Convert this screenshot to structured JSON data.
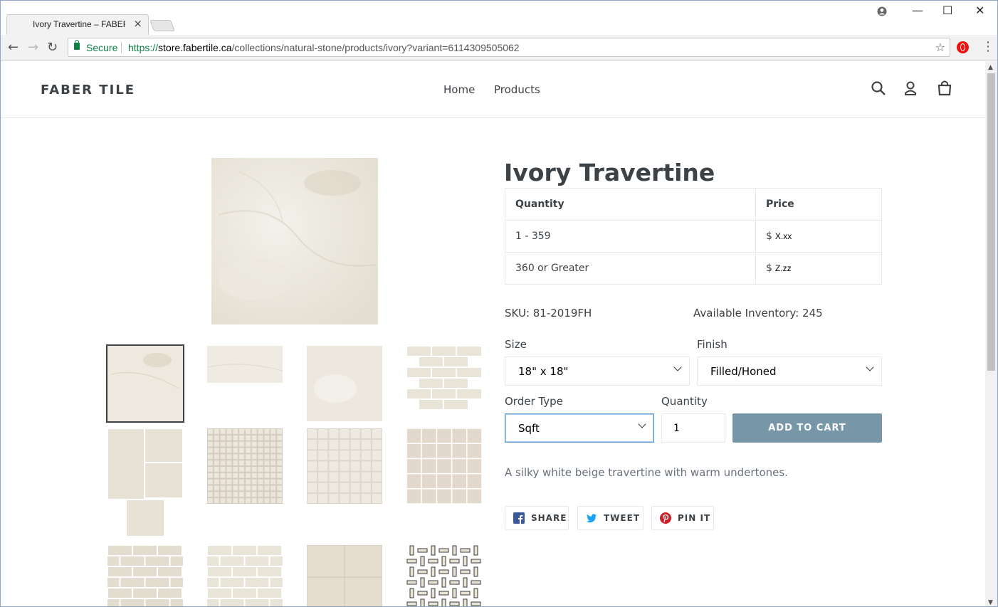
{
  "browser": {
    "tab_title": "Ivory Travertine – FABER TILE",
    "tab_close": "×",
    "security_label": "Secure",
    "url_scheme": "https://",
    "url_host": "store.fabertile.ca",
    "url_path": "/collections/natural-stone/products/ivory?variant=6114309505062",
    "window_controls": {
      "minimize": "—",
      "maximize": "☐",
      "close": "✕"
    },
    "nav": {
      "back": "←",
      "forward": "→",
      "reload": "↻",
      "menu": "⋮",
      "star": "☆"
    }
  },
  "site": {
    "logo": "FABER TILE",
    "nav": [
      "Home",
      "Products"
    ],
    "icons": [
      "search-icon",
      "account-icon",
      "cart-icon"
    ]
  },
  "product": {
    "title": "Ivory Travertine",
    "price_table": {
      "headers": [
        "Quantity",
        "Price"
      ],
      "rows": [
        {
          "qty": "1 - 359",
          "currency": "$",
          "price": "X.xx"
        },
        {
          "qty": "360 or Greater",
          "currency": "$",
          "price": "Z.zz"
        }
      ]
    },
    "sku": "SKU: 81-2019FH",
    "inventory": "Available Inventory: 245",
    "size_label": "Size",
    "size_value": "18\" x 18\"",
    "finish_label": "Finish",
    "finish_value": "Filled/Honed",
    "order_type_label": "Order Type",
    "order_type_value": "Sqft",
    "quantity_label": "Quantity",
    "quantity_value": "1",
    "add_to_cart": "ADD TO CART",
    "description": "A silky white beige travertine with warm undertones.",
    "share": [
      "SHARE",
      "TWEET",
      "PIN IT"
    ]
  },
  "colors": {
    "text": "#3d4246",
    "button": "#7796a8",
    "border": "#e8e9eb",
    "secure_green": "#0b8043"
  }
}
